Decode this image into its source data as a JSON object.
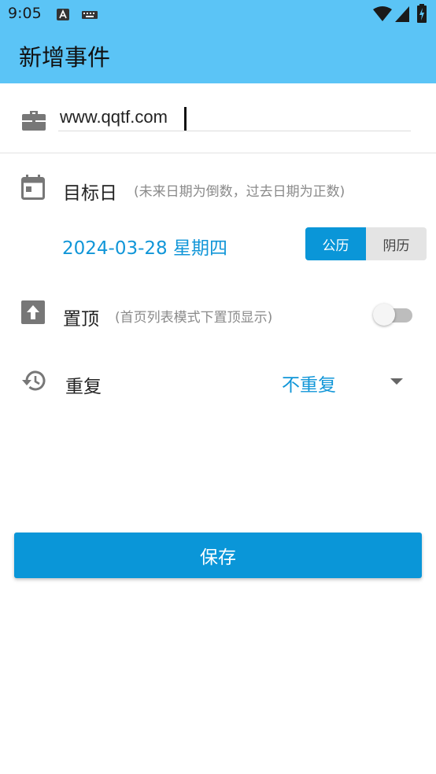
{
  "status_bar": {
    "time": "9:05",
    "icons": [
      "keyboard-a-icon",
      "keyboard-icon",
      "wifi-icon",
      "signal-icon",
      "battery-icon"
    ]
  },
  "app_bar": {
    "title": "新增事件"
  },
  "name_field": {
    "value": "www.qqtf.com",
    "icon": "briefcase-icon"
  },
  "target_date": {
    "label": "目标日",
    "hint": "(未来日期为倒数，过去日期为正数)",
    "date": "2024-03-28 星期四",
    "calendar_options": [
      "公历",
      "阴历"
    ],
    "selected_calendar": "公历"
  },
  "pin_top": {
    "label": "置顶",
    "hint": "(首页列表模式下置顶显示)",
    "enabled": false
  },
  "repeat": {
    "label": "重复",
    "value": "不重复"
  },
  "save_button": {
    "label": "保存"
  },
  "colors": {
    "app_bar": "#5bc4f6",
    "accent": "#0a96d8",
    "accent_text": "#1196d8",
    "icon_gray": "#777777"
  }
}
